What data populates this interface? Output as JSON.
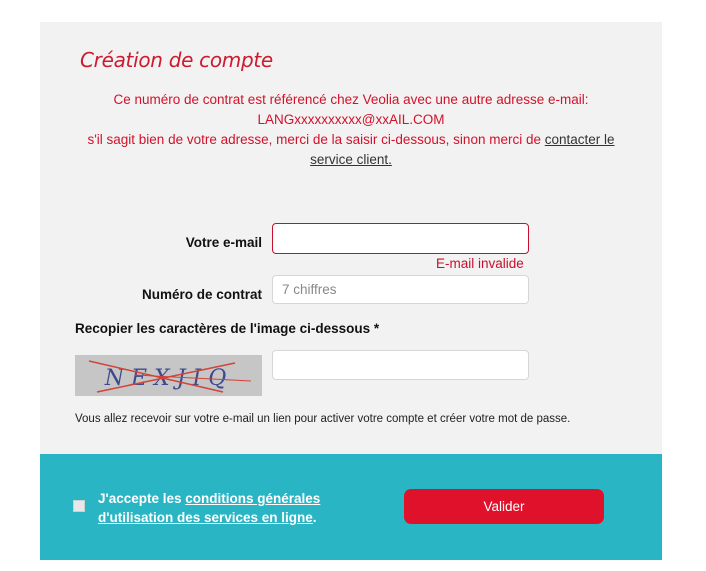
{
  "form": {
    "title": "Création de compte",
    "notice": {
      "line1": "Ce numéro de contrat est référencé chez Veolia avec une autre adresse e-mail:",
      "email": "LANGxxxxxxxxxx@xxAIL.COM",
      "line3_prefix": "s'il sagit bien de votre adresse, merci de la saisir ci-dessous, sinon merci de ",
      "link_text": "contacter le service client."
    },
    "email": {
      "label": "Votre e-mail",
      "value": "",
      "placeholder": "",
      "error": "E-mail invalide"
    },
    "contract": {
      "label": "Numéro de contrat",
      "value": "",
      "placeholder": "7 chiffres"
    },
    "captcha": {
      "label": "Recopier les caractères de l'image ci-dessous *",
      "image_text": "NEXJIQ",
      "value": "",
      "placeholder": ""
    },
    "info": "Vous allez recevoir sur votre e-mail un lien pour activer votre compte et créer votre mot de passe."
  },
  "footer": {
    "accept_prefix": "J'accepte les ",
    "accept_link": "conditions générales d'utilisation des services en ligne",
    "accept_suffix": ".",
    "checked": false,
    "submit_label": "Valider"
  },
  "colors": {
    "accent_red": "#e0112a",
    "footer_teal": "#29b5c4",
    "panel_gray": "#f2f2f2"
  }
}
